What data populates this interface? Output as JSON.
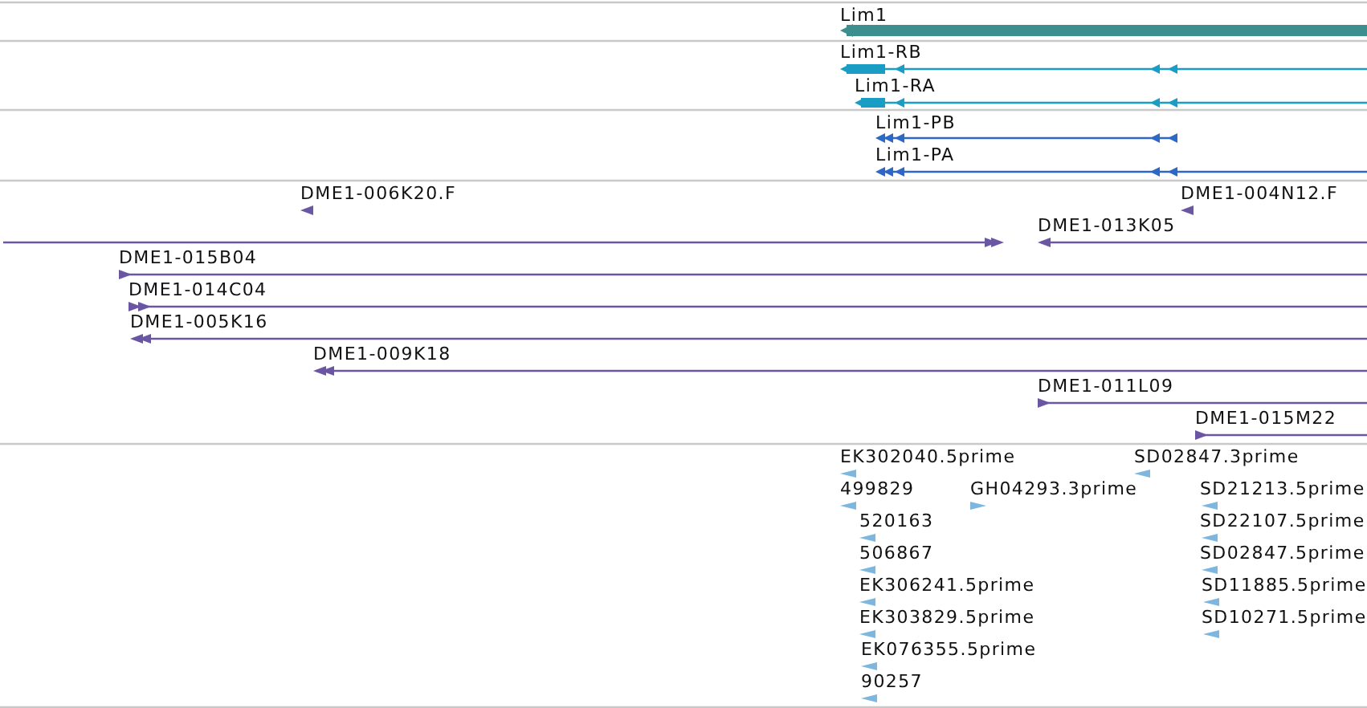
{
  "tracks": [
    {
      "kind": "gene",
      "features": [
        {
          "label": "Lim1",
          "reverse": true
        }
      ]
    },
    {
      "kind": "transcript",
      "features": [
        {
          "label": "Lim1-RB",
          "reverse": true
        },
        {
          "label": "Lim1-RA",
          "reverse": true
        }
      ]
    },
    {
      "kind": "protein",
      "features": [
        {
          "label": "Lim1-PB",
          "reverse": true
        },
        {
          "label": "Lim1-PA",
          "reverse": true
        }
      ]
    },
    {
      "kind": "clone",
      "features": [
        {
          "label": "DME1-006K20.F",
          "reverse": true
        },
        {
          "label": "DME1-004N12.F",
          "reverse": true
        },
        {
          "label": "DME1-013K05",
          "reverse": true
        },
        {
          "reverse": false
        },
        {
          "label": "DME1-015B04",
          "reverse": false
        },
        {
          "label": "DME1-014C04",
          "reverse": false
        },
        {
          "label": "DME1-005K16",
          "reverse": true
        },
        {
          "label": "DME1-009K18",
          "reverse": true
        },
        {
          "label": "DME1-011L09",
          "reverse": false
        },
        {
          "label": "DME1-015M22",
          "reverse": false
        }
      ]
    },
    {
      "kind": "est",
      "features": [
        {
          "label": "EK302040.5prime",
          "reverse": true
        },
        {
          "label": "SD02847.3prime",
          "reverse": true
        },
        {
          "label": "499829",
          "reverse": true
        },
        {
          "label": "GH04293.3prime",
          "reverse": false
        },
        {
          "label": "SD21213.5prime",
          "reverse": true
        },
        {
          "label": "520163",
          "reverse": true
        },
        {
          "label": "SD22107.5prime",
          "reverse": true
        },
        {
          "label": "506867",
          "reverse": true
        },
        {
          "label": "SD02847.5prime",
          "reverse": true
        },
        {
          "label": "EK306241.5prime",
          "reverse": true
        },
        {
          "label": "SD11885.5prime",
          "reverse": true
        },
        {
          "label": "EK303829.5prime",
          "reverse": true
        },
        {
          "label": "SD10271.5prime",
          "reverse": true
        },
        {
          "label": "EK076355.5prime",
          "reverse": true
        },
        {
          "label": "90257",
          "reverse": true
        }
      ]
    }
  ]
}
